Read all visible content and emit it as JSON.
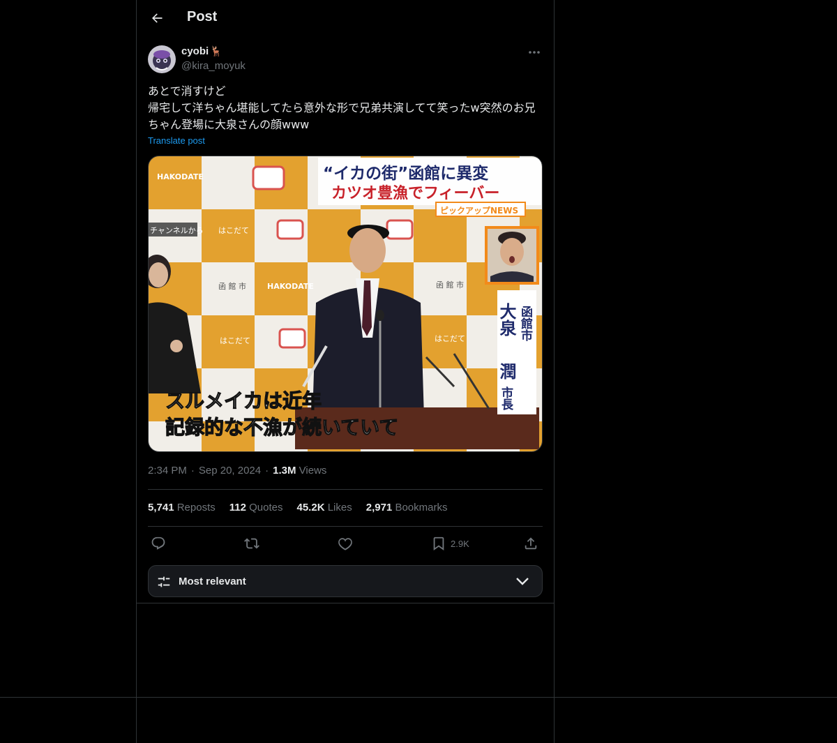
{
  "header": {
    "title": "Post",
    "back_icon": "arrow-left-icon"
  },
  "post": {
    "author": {
      "display_name": "cyobi",
      "name_emoji": "🦌",
      "handle": "@kira_moyuk",
      "avatar": "avatar"
    },
    "text": "あとで消すけど\n帰宅して洋ちゃん堪能してたら意外な形で兄弟共演してて笑ったw突然のお兄ちゃん登場に大泉さんの顔www",
    "translate_label": "Translate post",
    "media": {
      "headline_top": "“イカの街”函館に異変",
      "headline_bottom": "カツオ豊漁でフィーバー",
      "tag": "ピックアップNEWS",
      "left_tag": "チャンネルから",
      "name_vertical_1": "函館市",
      "name_vertical_2": "大泉",
      "name_vertical_3": "潤",
      "name_vertical_4": "市長",
      "caption_line1": "スルメイカは近年",
      "caption_line2": "記録的な不漁が続いていて",
      "backdrop_text_1": "HAKODATE",
      "backdrop_text_2": "函 館 市",
      "backdrop_text_3": "はこだて"
    },
    "time": "2:34 PM",
    "date": "Sep 20, 2024",
    "views_count": "1.3M",
    "views_label": "Views",
    "stats": [
      {
        "count": "5,741",
        "label": "Reposts"
      },
      {
        "count": "112",
        "label": "Quotes"
      },
      {
        "count": "45.2K",
        "label": "Likes"
      },
      {
        "count": "2,971",
        "label": "Bookmarks"
      }
    ],
    "actions": {
      "reply_icon": "reply-icon",
      "repost_icon": "repost-icon",
      "like_icon": "heart-icon",
      "bookmark_icon": "bookmark-icon",
      "bookmark_count": "2.9K",
      "share_icon": "share-icon"
    }
  },
  "replies_sort": {
    "label": "Most relevant",
    "icon": "sliders-icon"
  },
  "colors": {
    "background": "#000000",
    "text": "#e7e9ea",
    "muted": "#71767b",
    "link": "#1d9bf0",
    "border": "#2f3336"
  }
}
